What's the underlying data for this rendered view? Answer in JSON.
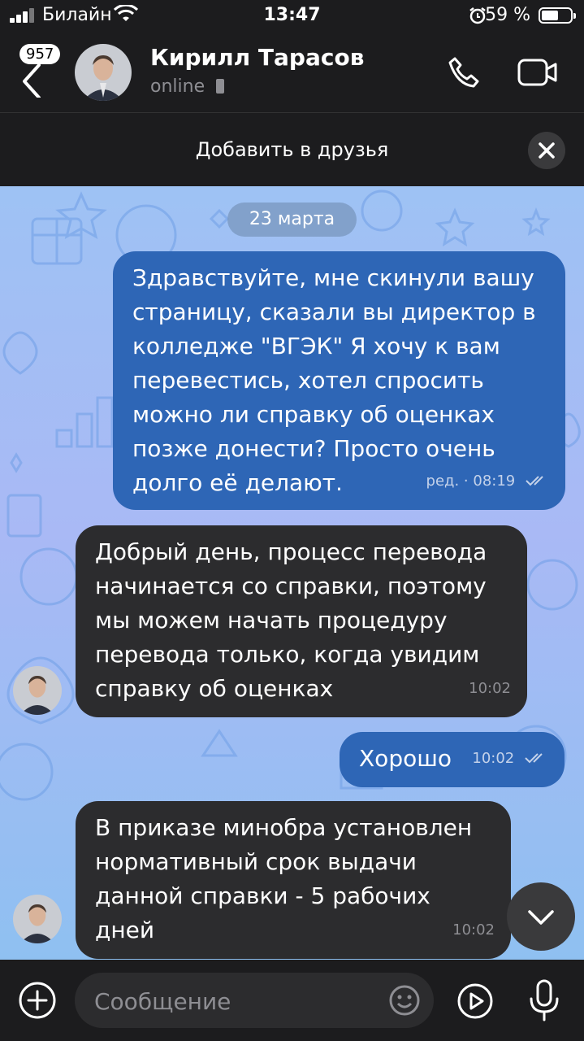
{
  "status_bar": {
    "carrier": "Билайн",
    "time": "13:47",
    "battery": "59 %",
    "battery_level": 0.59
  },
  "header": {
    "back_badge": "957",
    "contact_name": "Кирилл Тарасов",
    "presence": "online"
  },
  "add_friend": {
    "label": "Добавить в друзья"
  },
  "chat": {
    "date": "23 марта",
    "messages": [
      {
        "direction": "out",
        "text": "Здравствуйте, мне скинули вашу\nстраницу, сказали вы директор в\nколледже \"ВГЭК\" Я хочу к вам\nперевестись, хотел спросить\nможно ли справку об оценках\nпозже донести? Просто очень\nдолго её делают.",
        "meta": "ред. · 08:19"
      },
      {
        "direction": "in",
        "text": "Добрый день, процесс перевода\nначинается со справки, поэтому\nмы можем начать процедуру\nперевода только, когда увидим\nсправку об оценках",
        "meta": "10:02"
      },
      {
        "direction": "out",
        "text": "Хорошо",
        "meta": "10:02"
      },
      {
        "direction": "in",
        "text": "В приказе минобра установлен\nнормативный срок выдачи\nданной справки - 5 рабочих\nдней",
        "meta": "10:02"
      }
    ]
  },
  "input": {
    "placeholder": "Сообщение"
  },
  "colors": {
    "outgoing_bubble": "#2e66b6",
    "incoming_bubble": "#2c2c2e",
    "background": "#1c1c1e"
  },
  "icons": [
    "signal-icon",
    "wifi-icon",
    "alarm-icon",
    "battery-icon",
    "back-icon",
    "phone-icon",
    "video-icon",
    "close-icon",
    "read-checks-icon",
    "chevron-down-icon",
    "plus-icon",
    "smile-icon",
    "play-icon",
    "mic-icon"
  ]
}
